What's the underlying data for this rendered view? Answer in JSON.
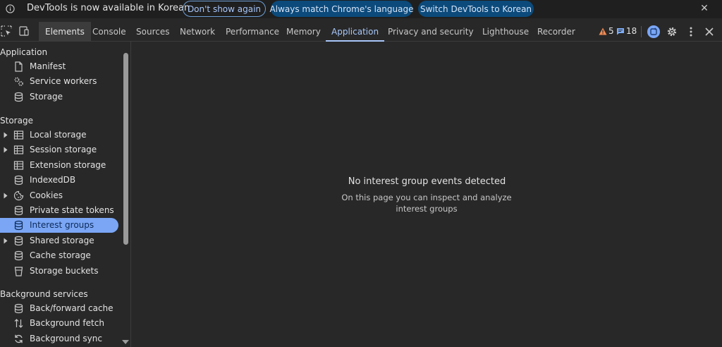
{
  "infobar": {
    "message": "DevTools is now available in Korean",
    "dont_show": "Don't show again",
    "always_match": "Always match Chrome's language",
    "switch_lang": "Switch DevTools to Korean"
  },
  "tabs": [
    {
      "label": "Elements"
    },
    {
      "label": "Console"
    },
    {
      "label": "Sources"
    },
    {
      "label": "Network"
    },
    {
      "label": "Performance"
    },
    {
      "label": "Memory"
    },
    {
      "label": "Application"
    },
    {
      "label": "Privacy and security"
    },
    {
      "label": "Lighthouse"
    },
    {
      "label": "Recorder"
    }
  ],
  "active_tab": "Application",
  "counters": {
    "warnings": "5",
    "messages": "18"
  },
  "colors": {
    "accent": "#a8c7fa",
    "warning": "#f28b54",
    "message": "#7cacf8",
    "selected": "#7aa6f5"
  },
  "sidebar": {
    "sections": [
      {
        "title": "Application",
        "items": [
          {
            "label": "Manifest",
            "icon": "document-icon"
          },
          {
            "label": "Service workers",
            "icon": "gears-icon"
          },
          {
            "label": "Storage",
            "icon": "database-icon"
          }
        ]
      },
      {
        "title": "Storage",
        "items": [
          {
            "label": "Local storage",
            "icon": "table-icon",
            "expandable": true
          },
          {
            "label": "Session storage",
            "icon": "table-icon",
            "expandable": true
          },
          {
            "label": "Extension storage",
            "icon": "table-icon"
          },
          {
            "label": "IndexedDB",
            "icon": "database-icon"
          },
          {
            "label": "Cookies",
            "icon": "cookie-icon",
            "expandable": true
          },
          {
            "label": "Private state tokens",
            "icon": "database-icon"
          },
          {
            "label": "Interest groups",
            "icon": "database-icon",
            "selected": true
          },
          {
            "label": "Shared storage",
            "icon": "database-icon",
            "expandable": true
          },
          {
            "label": "Cache storage",
            "icon": "database-icon"
          },
          {
            "label": "Storage buckets",
            "icon": "bucket-icon"
          }
        ]
      },
      {
        "title": "Background services",
        "items": [
          {
            "label": "Back/forward cache",
            "icon": "database-icon"
          },
          {
            "label": "Background fetch",
            "icon": "up-down-arrows-icon"
          },
          {
            "label": "Background sync",
            "icon": "sync-icon"
          }
        ]
      }
    ]
  },
  "main": {
    "empty_title": "No interest group events detected",
    "empty_desc": "On this page you can inspect and analyze interest groups"
  }
}
